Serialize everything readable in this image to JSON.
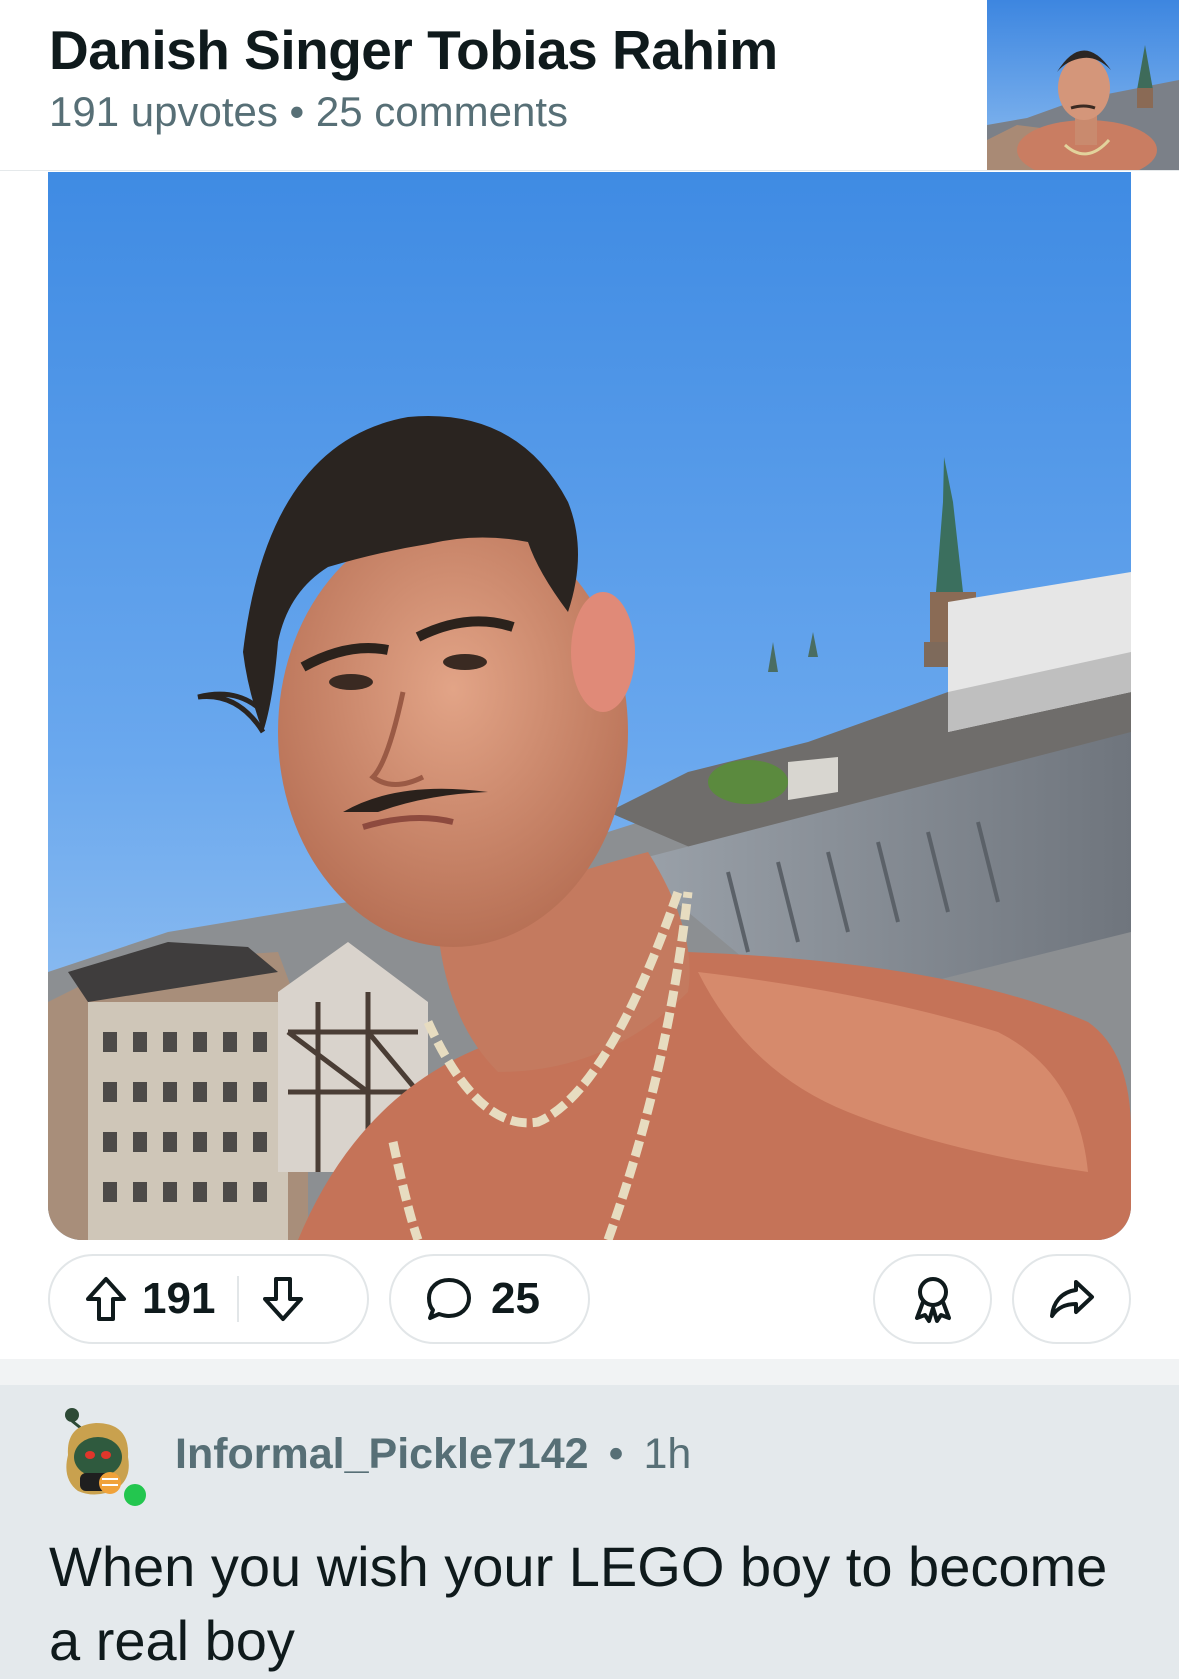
{
  "post": {
    "title": "Danish Singer Tobias Rahim",
    "upvotes_text": "191 upvotes",
    "comments_text": "25 comments",
    "meta_separator": "•"
  },
  "actions": {
    "vote_count": "191",
    "comment_count": "25",
    "icons": [
      "upvote-arrow-icon",
      "downvote-arrow-icon",
      "comment-bubble-icon",
      "award-icon",
      "share-icon"
    ]
  },
  "comment": {
    "username": "Informal_Pickle7142",
    "separator": "•",
    "time": "1h",
    "body": "When you wish your LEGO boy to become a real boy",
    "online_status_color": "#23c64f"
  },
  "colors": {
    "meta_text": "#576f76",
    "comment_background": "#e4e9ec",
    "pill_border": "#e2e6e8"
  }
}
